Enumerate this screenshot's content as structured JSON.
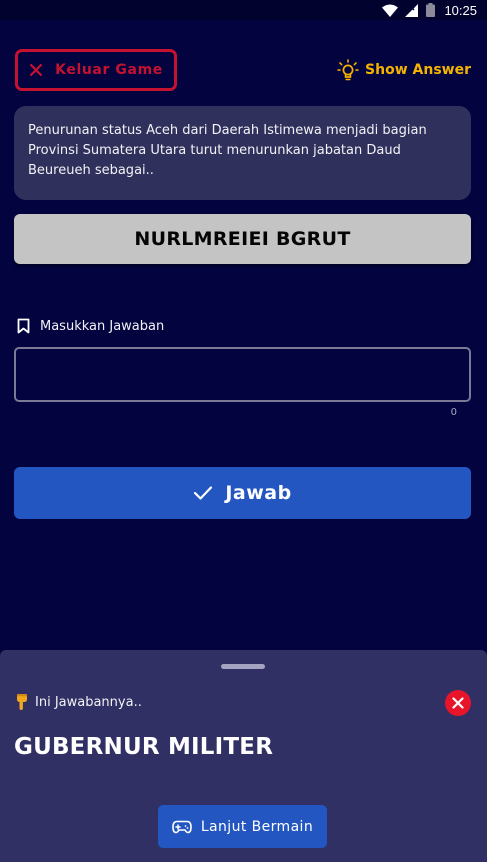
{
  "status_bar": {
    "time": "10:25"
  },
  "header": {
    "exit_label": "Keluar Game",
    "show_answer_label": "Show Answer"
  },
  "question": {
    "text": "Penurunan status Aceh dari Daerah Istimewa menjadi bagian Provinsi Sumatera Utara turut menurunkan jabatan Daud Beureueh sebagai..",
    "scrambled": "NURLMREIEI BGRUT"
  },
  "answer_form": {
    "label": "Masukkan Jawaban",
    "value": "",
    "placeholder": "",
    "char_count": "0",
    "submit_label": "Jawab"
  },
  "sheet": {
    "hint": "Ini Jawabannya..",
    "answer": "GUBERNUR MILITER",
    "continue_label": "Lanjut Bermain"
  },
  "colors": {
    "background": "#03033f",
    "card": "#30305c",
    "accent_blue": "#2356c0",
    "danger": "#c41230",
    "warning": "#f5b301"
  },
  "icons": {
    "exit": "close-icon",
    "show_answer": "lightbulb-icon",
    "answer_label": "bookmark-icon",
    "submit": "check-icon",
    "hint": "pointing-down-hand-icon",
    "close": "close-circle-icon",
    "continue": "gamepad-icon"
  }
}
